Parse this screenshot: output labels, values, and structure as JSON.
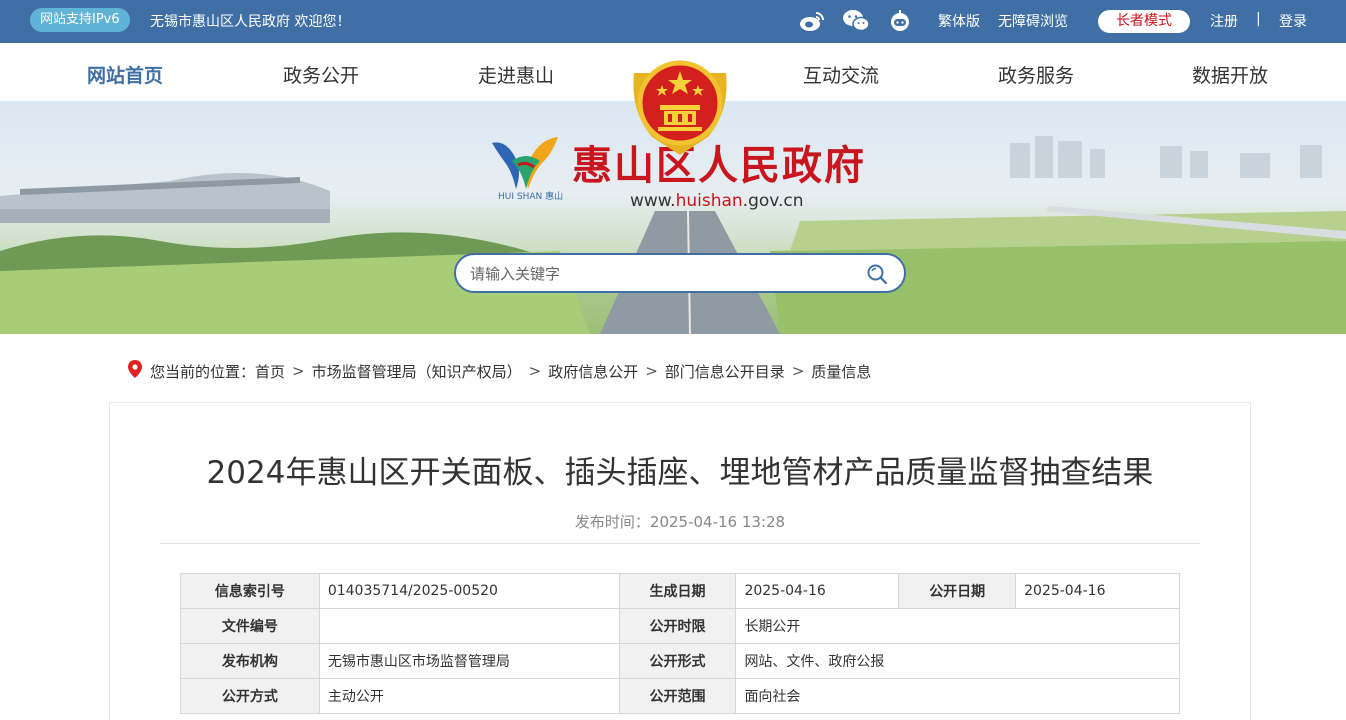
{
  "topbar": {
    "ipv6": "网站支持IPv6",
    "welcome": "无锡市惠山区人民政府 欢迎您！",
    "icons": [
      "weibo-icon",
      "wechat-icon",
      "robot-icon"
    ],
    "traditional": "繁体版",
    "accessible": "无障碍浏览",
    "elder_mode": "长者模式",
    "register": "注册",
    "separator": "|",
    "login": "登录"
  },
  "nav": {
    "items": [
      "网站首页",
      "政务公开",
      "走进惠山",
      "互动交流",
      "政务服务",
      "数据开放"
    ]
  },
  "banner": {
    "site_name": "惠山区人民政府",
    "url_prefix": "www.",
    "url_highlight": "huishan",
    "url_suffix": ".gov.cn",
    "logo_sub": "HUI SHAN 惠山"
  },
  "search": {
    "placeholder": "请输入关键字"
  },
  "breadcrumb": {
    "label": "您当前的位置：",
    "items": [
      "首页",
      "市场监督管理局（知识产权局）",
      "政府信息公开",
      "部门信息公开目录",
      "质量信息"
    ]
  },
  "article": {
    "title": "2024年惠山区开关面板、插头插座、埋地管材产品质量监督抽查结果",
    "publish": "发布时间：2025-04-16 13:28"
  },
  "meta": {
    "index_label": "信息索引号",
    "index_value": "014035714/2025-00520",
    "gen_date_label": "生成日期",
    "gen_date_value": "2025-04-16",
    "open_date_label": "公开日期",
    "open_date_value": "2025-04-16",
    "doc_no_label": "文件编号",
    "doc_no_value": "",
    "limit_label": "公开时限",
    "limit_value": "长期公开",
    "org_label": "发布机构",
    "org_value": "无锡市惠山区市场监督管理局",
    "form_label": "公开形式",
    "form_value": "网站、文件、政府公报",
    "mode_label": "公开方式",
    "mode_value": "主动公开",
    "scope_label": "公开范围",
    "scope_value": "面向社会"
  },
  "colors": {
    "brand_blue": "#3f6fa5",
    "brand_red": "#c9161e"
  }
}
